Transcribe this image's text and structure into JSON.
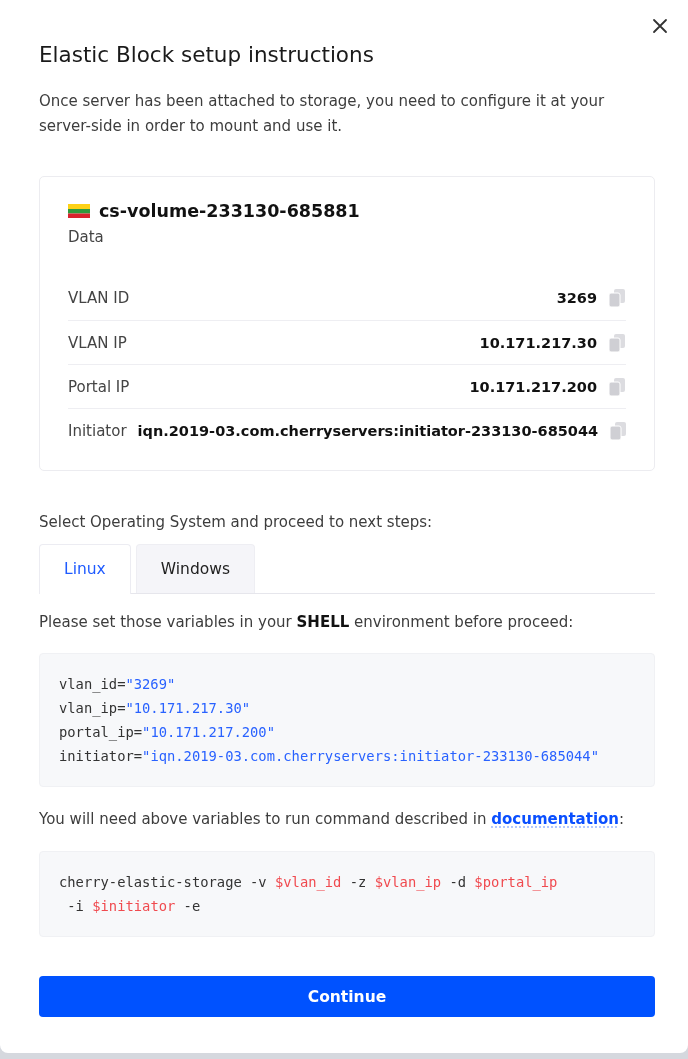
{
  "dialog": {
    "title": "Elastic Block setup instructions",
    "intro": "Once server has been attached to storage, you need to configure it at your server-side in order to mount and use it."
  },
  "volume": {
    "name": "cs-volume-233130-685881",
    "description": "Data"
  },
  "details": [
    {
      "label": "VLAN ID",
      "value": "3269"
    },
    {
      "label": "VLAN IP",
      "value": "10.171.217.30"
    },
    {
      "label": "Portal IP",
      "value": "10.171.217.200"
    },
    {
      "label": "Initiator",
      "value": "iqn.2019-03.com.cherryservers:initiator-233130-685044"
    }
  ],
  "os_prompt": "Select Operating System and proceed to next steps:",
  "tabs": [
    {
      "label": "Linux",
      "selected": true
    },
    {
      "label": "Windows",
      "selected": false
    }
  ],
  "shell_note": "Please set those variables in your **SHELL** environment before proceed:",
  "variables_code": [
    [
      {
        "kind": "plain",
        "text": "vlan_id="
      },
      {
        "kind": "string",
        "text": "\"3269\""
      }
    ],
    [
      {
        "kind": "plain",
        "text": "vlan_ip="
      },
      {
        "kind": "string",
        "text": "\"10.171.217.30\""
      }
    ],
    [
      {
        "kind": "plain",
        "text": "portal_ip="
      },
      {
        "kind": "string",
        "text": "\"10.171.217.200\""
      }
    ],
    [
      {
        "kind": "plain",
        "text": "initiator="
      },
      {
        "kind": "string",
        "text": "\"iqn.2019-03.com.cherryservers:initiator-233130-685044\""
      }
    ]
  ],
  "command_note": {
    "text": "You will need above variables to run command described in ",
    "link": "documentation",
    "suffix": ":"
  },
  "command_code": [
    [
      {
        "kind": "plain",
        "text": "cherry-elastic-storage -v "
      },
      {
        "kind": "variable",
        "text": "$vlan_id"
      },
      {
        "kind": "plain",
        "text": " -z "
      },
      {
        "kind": "variable",
        "text": "$vlan_ip"
      },
      {
        "kind": "plain",
        "text": " -d "
      },
      {
        "kind": "variable",
        "text": "$portal_ip"
      }
    ],
    [
      {
        "kind": "plain",
        "text": " -i "
      },
      {
        "kind": "variable",
        "text": "$initiator"
      },
      {
        "kind": "plain",
        "text": " -e"
      }
    ]
  ],
  "continue_button": {
    "label": "Continue"
  }
}
